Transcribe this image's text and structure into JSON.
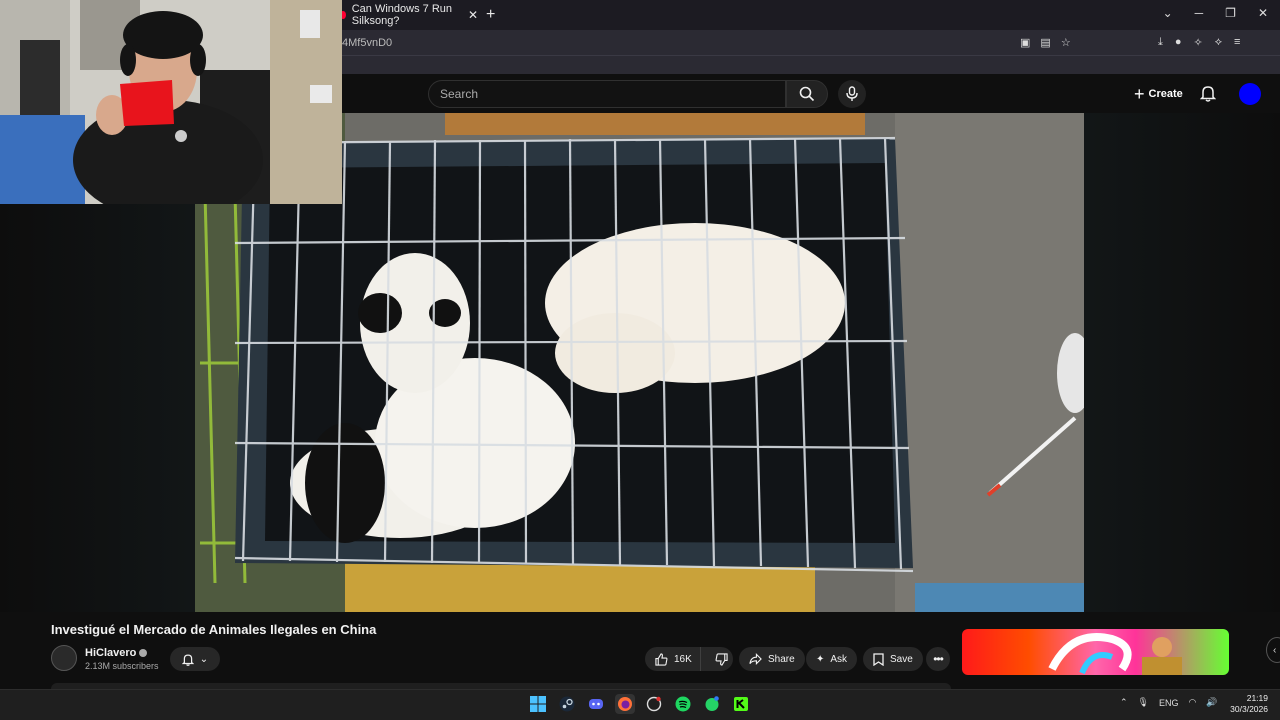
{
  "browser": {
    "tab_title": "Can Windows 7 Run Silksong?",
    "url_fragment": "4Mf5vnD0"
  },
  "header": {
    "search_placeholder": "Search",
    "create_label": "Create"
  },
  "video": {
    "title": "Investigué el Mercado de Animales Ilegales en China",
    "channel": "HiClavero",
    "subscribers": "2.13M subscribers",
    "likes": "16K",
    "share_label": "Share",
    "ask_label": "Ask",
    "save_label": "Save"
  },
  "taskbar": {
    "language": "ENG",
    "time": "21:19",
    "date": "30/3/2026",
    "apps": [
      "windows-start",
      "steam",
      "discord",
      "firefox",
      "chatgpt",
      "spotify",
      "whatsapp",
      "kick"
    ]
  },
  "colors": {
    "background": "#0f0f0f",
    "avatar": "#0000ff",
    "mug": "#e8141c"
  }
}
